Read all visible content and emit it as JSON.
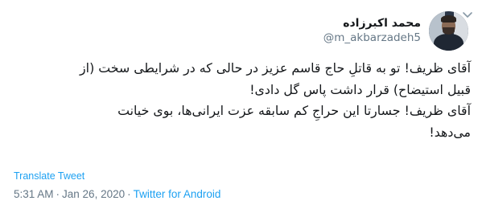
{
  "author": {
    "display_name": "محمد اکبرزاده",
    "handle": "@m_akbarzadeh5"
  },
  "tweet": {
    "lines": [
      "آقای ظریف! تو به قاتلِ حاج قاسم عزیز در حالی که در شرایطی سخت (از",
      "قبیل استیضاح) قرار داشت پاس گل دادی!",
      "آقای ظریف! جسارتا این حراجِ کم سابقه عزت ایرانی‌ها، بوی خیانت",
      "می‌دهد!"
    ],
    "translate_label": "Translate Tweet",
    "time": "5:31 AM",
    "separator": "·",
    "date": "Jan 26, 2020",
    "source": "Twitter for Android"
  },
  "icons": {
    "menu": "chevron-down-icon",
    "avatar": "profile-photo"
  },
  "colors": {
    "link": "#1da1f2",
    "text": "#14171a",
    "secondary": "#657786"
  }
}
